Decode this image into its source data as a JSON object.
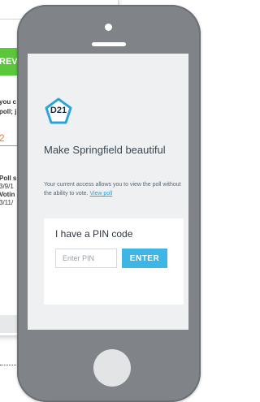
{
  "background": {
    "green_button_label": "REV",
    "lines": [
      "you c",
      "poll; j",
      "2",
      "Poll s",
      "3/9/1",
      "Votin",
      "3/11/"
    ]
  },
  "screen": {
    "badge": "D21",
    "title": "Make Springfield beautiful",
    "description": "Your current access allows you to view the poll without the ability to vote.",
    "view_poll_link": "View poll",
    "pin": {
      "heading": "I have a PIN code",
      "input_placeholder": "Enter PIN",
      "enter_button": "ENTER"
    }
  },
  "colors": {
    "accent_blue": "#3db6e6",
    "link_blue": "#2aa5dc",
    "green": "#5cc73c",
    "phone_body": "#808488"
  }
}
